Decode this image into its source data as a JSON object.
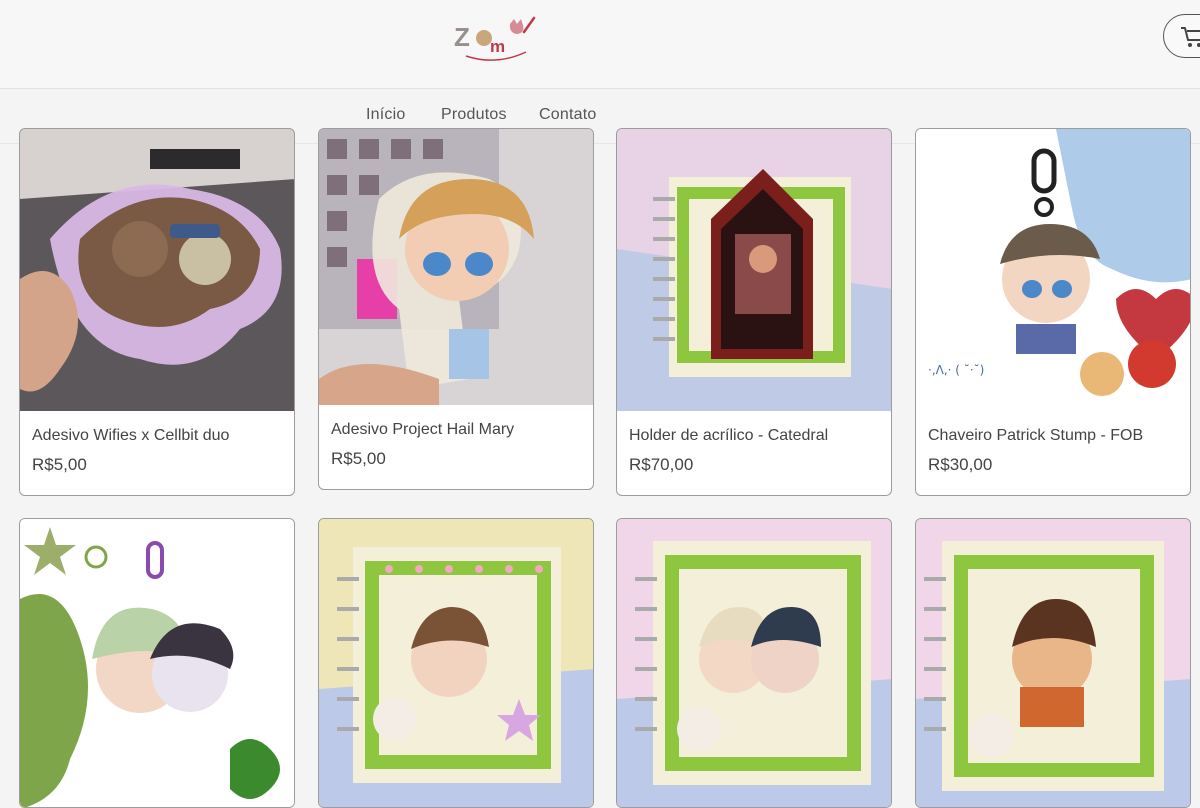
{
  "header": {
    "logo_text": "Zomy",
    "logo_icon": "logo-mark",
    "cart_icon": "cart-icon"
  },
  "nav": {
    "items": [
      "Início",
      "Produtos",
      "Contato"
    ]
  },
  "products": [
    {
      "title": "Adesivo Wifies x Cellbit duo",
      "price": "R$5,00"
    },
    {
      "title": "Adesivo Project Hail Mary",
      "price": "R$5,00"
    },
    {
      "title": "Holder de acrílico - Catedral",
      "price": "R$70,00"
    },
    {
      "title": "Chaveiro Patrick Stump - FOB",
      "price": "R$30,00"
    },
    {
      "title": "",
      "price": ""
    },
    {
      "title": "",
      "price": ""
    },
    {
      "title": "",
      "price": ""
    },
    {
      "title": "",
      "price": ""
    }
  ],
  "colors": {
    "accent": "#c0394a",
    "card_border": "#9c9c9c",
    "frame_green": "#8ec63f",
    "frame_pink": "#f4a7c0"
  }
}
